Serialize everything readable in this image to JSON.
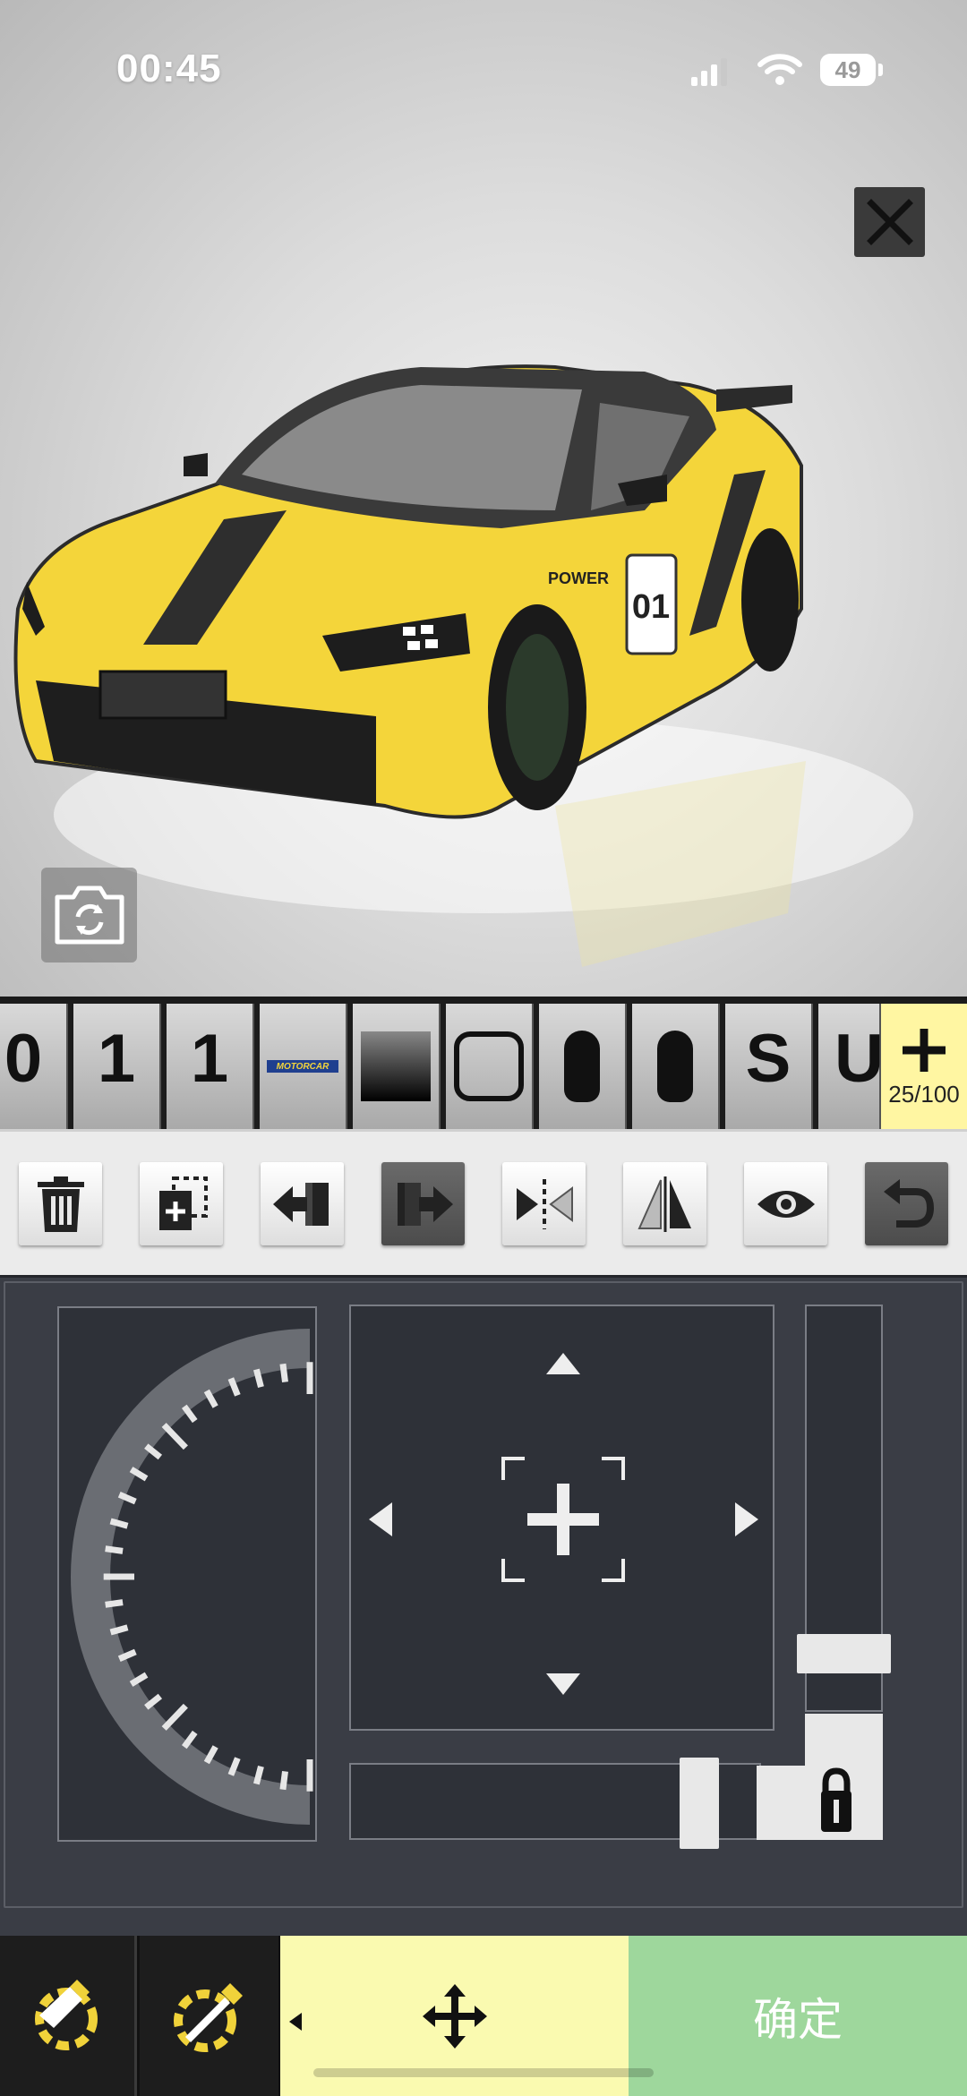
{
  "status_bar": {
    "time": "00:45",
    "battery": "49"
  },
  "layers": {
    "visible_chars": [
      "0",
      "1",
      "1"
    ],
    "tile_S": "S",
    "tile_U": "U",
    "logo_text": "MOTORCAR",
    "count": "25/100"
  },
  "car": {
    "number": "01",
    "brand_sticker": "POWER",
    "body_color": "#f4d53a",
    "stripe_color": "#2a2a2a"
  },
  "colors": {
    "panel_bg": "#3a3d45",
    "move_button": "#fafab0",
    "confirm_button": "#9ed79c",
    "add_layer_bg": "#fff6a2"
  },
  "bottom_bar": {
    "confirm_label": "确定"
  },
  "icons": [
    "close-icon",
    "camera-rotate-icon",
    "plus-icon",
    "trash-icon",
    "duplicate-icon",
    "send-backward-icon",
    "bring-forward-icon",
    "flip-horizontal-icon",
    "flip-vertical-icon",
    "eye-icon",
    "undo-icon",
    "crosshair-icon",
    "lock-icon",
    "brush-icon",
    "sticker-icon",
    "move-icon"
  ]
}
